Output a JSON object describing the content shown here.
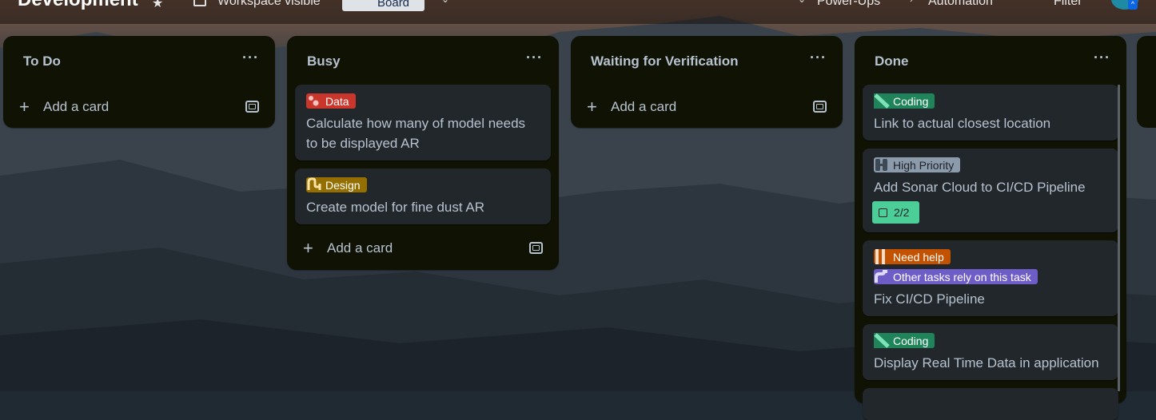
{
  "colors": {
    "list_bg": "#101204",
    "card_bg": "#22272b",
    "text": "#b6c2cf",
    "label_data": "#c9372c",
    "label_design": "#946f00",
    "label_coding": "#1f845a",
    "label_high_priority": "#8c9bab",
    "label_need_help": "#c25100",
    "label_rely": "#6e5dc6",
    "checklist_complete": "#4bce97"
  },
  "header": {
    "board_title": "Development",
    "star_icon": "star-icon",
    "visibility": "Workspace visible",
    "view": "Board",
    "power_ups": "Power-Ups",
    "automation": "Automation",
    "filter": "Filter"
  },
  "lists": [
    {
      "title": "To Do",
      "menu": "···",
      "add_card": "Add a card",
      "cards": []
    },
    {
      "title": "Busy",
      "menu": "···",
      "add_card": "Add a card",
      "cards": [
        {
          "labels": [
            {
              "text": "Data",
              "icon": "data-label-icon"
            }
          ],
          "title_lines": [
            "Calculate how many of model needs",
            "to be displayed AR"
          ]
        },
        {
          "labels": [
            {
              "text": "Design",
              "icon": "design-label-icon"
            }
          ],
          "title_lines": [
            "Create model for fine dust AR"
          ]
        }
      ]
    },
    {
      "title": "Waiting for Verification",
      "menu": "···",
      "add_card": "Add a card",
      "cards": []
    },
    {
      "title": "Done",
      "menu": "···",
      "cards": [
        {
          "labels": [
            {
              "text": "Coding",
              "icon": "coding-label-icon"
            }
          ],
          "title_lines": [
            "Link to actual closest location"
          ]
        },
        {
          "labels": [
            {
              "text": "High Priority",
              "icon": "high-priority-label-icon"
            }
          ],
          "title_lines": [
            "Add Sonar Cloud to CI/CD Pipeline"
          ],
          "checklist": "2/2"
        },
        {
          "labels": [
            {
              "text": "Need help",
              "icon": "need-help-label-icon"
            },
            {
              "text": "Other tasks rely on this task",
              "icon": "dependency-label-icon"
            }
          ],
          "title_lines": [
            "Fix CI/CD Pipeline"
          ]
        },
        {
          "labels": [
            {
              "text": "Coding",
              "icon": "coding-label-icon"
            }
          ],
          "title_lines": [
            "Display Real Time Data in application"
          ]
        }
      ]
    }
  ]
}
